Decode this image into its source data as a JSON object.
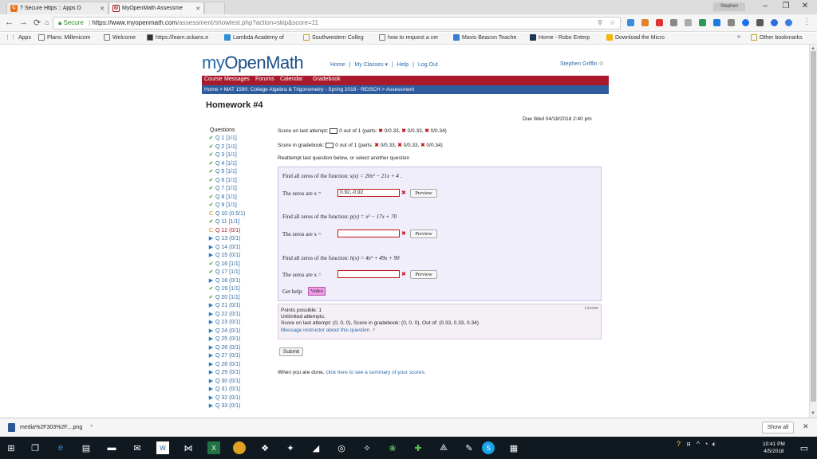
{
  "browser": {
    "tabs": [
      {
        "title": "? Secure Https :: Apps D",
        "icon": "c-icon"
      },
      {
        "title": "MyOpenMath Assessme",
        "icon": "m-icon"
      }
    ],
    "user_chip": "Stephen",
    "address": {
      "secure_label": "Secure",
      "domain": "https://www.myopenmath.com",
      "path": "/assessment/showtest.php?action=skip&score=11"
    },
    "bookmarks": [
      {
        "label": "Apps"
      },
      {
        "label": "Plans: Millenicom"
      },
      {
        "label": "Welcome"
      },
      {
        "label": "https://learn.sckans.e"
      },
      {
        "label": "Lambda Academy of"
      },
      {
        "label": "Southwestern Colleg"
      },
      {
        "label": "how to request a cer"
      },
      {
        "label": "Mavis Beacon Teache"
      },
      {
        "label": "Home - Robo Enterp"
      },
      {
        "label": "Download the Micro"
      }
    ],
    "bookmarks_overflow": "»",
    "other_bookmarks": "Other bookmarks"
  },
  "site": {
    "logo_my": "my",
    "logo_rest": "OpenMath",
    "topnav": [
      "Home",
      "|",
      "My Classes ▾",
      "|",
      "Help",
      "|",
      "Log Out"
    ],
    "username": "Stephen Griffin",
    "menu": [
      "Course",
      "Messages",
      "Forums",
      "Calendar",
      "Gradebook"
    ],
    "breadcrumb": "Home > MAT 1590: College Algebra & Trigonometry - Spring 2018 - REISCH > Assessment"
  },
  "assessment": {
    "title": "Homework #4",
    "due": "Due Wed 04/18/2018 2:40 pm",
    "questions_header": "Questions",
    "questions": [
      {
        "label": "Q 1 [1/1]",
        "status": "c"
      },
      {
        "label": "Q 2 [1/1]",
        "status": "c"
      },
      {
        "label": "Q 3 [1/1]",
        "status": "c"
      },
      {
        "label": "Q 4 [1/1]",
        "status": "c"
      },
      {
        "label": "Q 5 [1/1]",
        "status": "c"
      },
      {
        "label": "Q 6 [1/1]",
        "status": "c"
      },
      {
        "label": "Q 7 [1/1]",
        "status": "c"
      },
      {
        "label": "Q 8 [1/1]",
        "status": "c"
      },
      {
        "label": "Q 9 [1/1]",
        "status": "c"
      },
      {
        "label": "Q 10 (0.5/1)",
        "status": "p"
      },
      {
        "label": "Q 11 [1/1]",
        "status": "c"
      },
      {
        "label": "Q 12 (0/1)",
        "status": "p",
        "current": true
      },
      {
        "label": "Q 13 (0/1)",
        "status": "u"
      },
      {
        "label": "Q 14 (0/1)",
        "status": "u"
      },
      {
        "label": "Q 15 (0/1)",
        "status": "u"
      },
      {
        "label": "Q 16 [1/1]",
        "status": "c"
      },
      {
        "label": "Q 17 [1/1]",
        "status": "c"
      },
      {
        "label": "Q 18 (0/1)",
        "status": "u"
      },
      {
        "label": "Q 19 [1/1]",
        "status": "c"
      },
      {
        "label": "Q 20 [1/1]",
        "status": "c"
      },
      {
        "label": "Q 21 (0/1)",
        "status": "u"
      },
      {
        "label": "Q 22 (0/1)",
        "status": "u"
      },
      {
        "label": "Q 23 (0/1)",
        "status": "u"
      },
      {
        "label": "Q 24 (0/1)",
        "status": "u"
      },
      {
        "label": "Q 25 (0/1)",
        "status": "u"
      },
      {
        "label": "Q 26 (0/1)",
        "status": "u"
      },
      {
        "label": "Q 27 (0/1)",
        "status": "u"
      },
      {
        "label": "Q 28 (0/1)",
        "status": "u"
      },
      {
        "label": "Q 29 (0/1)",
        "status": "u"
      },
      {
        "label": "Q 30 (0/1)",
        "status": "u"
      },
      {
        "label": "Q 31 (0/1)",
        "status": "u"
      },
      {
        "label": "Q 32 (0/1)",
        "status": "u"
      },
      {
        "label": "Q 33 (0/1)",
        "status": "u"
      }
    ],
    "score_last": {
      "prefix": "Score on last attempt:",
      "text": "0 out of 1 (parts:",
      "p1": "0/0.33,",
      "p2": "0/0.33,",
      "p3": "0/0.34)"
    },
    "score_grade": {
      "prefix": "Score in gradebook:",
      "text": "0 out of 1 (parts:",
      "p1": "0/0.33,",
      "p2": "0/0.33,",
      "p3": "0/0.34)"
    },
    "reattempt": "Reattempt last question below, or select another question",
    "parts": [
      {
        "prompt": "Find all zeros of the function:",
        "func": "s(x) = 20x² − 21x + 4",
        "zeros_label": "The zeros are x =",
        "answer": "0.92,-0.92",
        "preview": "Preview"
      },
      {
        "prompt": "Find all zeros of the function:",
        "func": "p(x) = x² − 17x + 70",
        "zeros_label": "The zeros are x =",
        "answer": "",
        "preview": "Preview"
      },
      {
        "prompt": "Find all zeros of the function:",
        "func": "h(x) = 4x² + 49x + 90",
        "zeros_label": "The zeros are x =",
        "answer": "",
        "preview": "Preview"
      }
    ],
    "help_label": "Get help:",
    "video_label": "Video",
    "points": "Points possible: 1",
    "attempts": "Unlimited attempts.",
    "score_summary": "Score on last attempt: (0, 0, 0), Score in gradebook: (0, 0, 0), Out of: (0.33, 0.33, 0.34)",
    "message_instructor": "Message instructor about this question",
    "license": "License",
    "submit": "Submit",
    "done_prefix": "When you are done,",
    "done_link": "click here to see a summary of your scores."
  },
  "download": {
    "file": "media%2F303%2F....png",
    "show_all": "Show all"
  },
  "taskbar": {
    "time": "10:41 PM",
    "date": "4/5/2018"
  }
}
